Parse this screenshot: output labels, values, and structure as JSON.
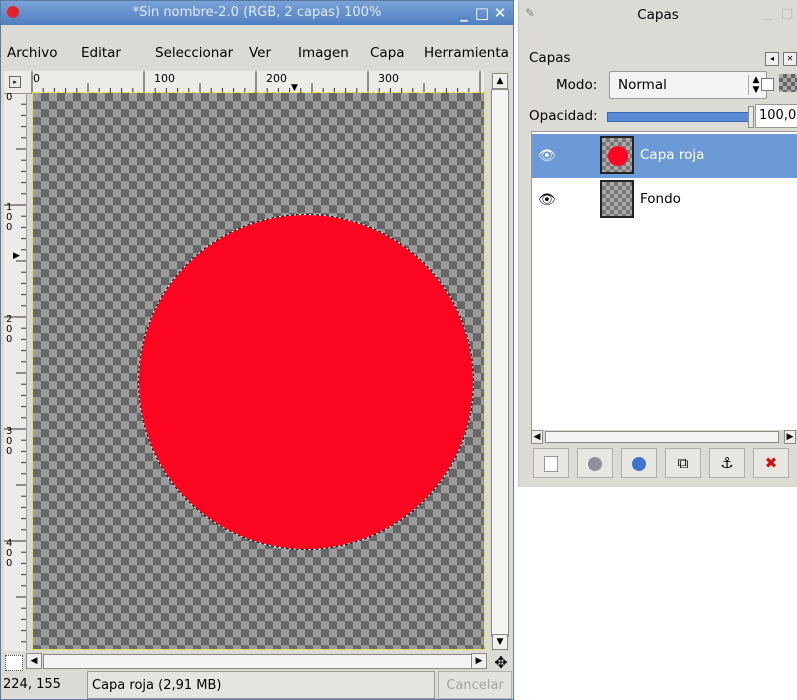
{
  "image_window": {
    "title": "*Sin nombre-2.0 (RGB, 2 capas) 100%",
    "menu": [
      "Archivo",
      "Editar",
      "Seleccionar",
      "Ver",
      "Imagen",
      "Capa",
      "Herramienta"
    ],
    "ruler_h_labels": [
      "0",
      "100",
      "200",
      "300"
    ],
    "ruler_v_labels": [
      "0",
      "100",
      "200",
      "300",
      "400"
    ],
    "status": {
      "coords": "224, 155",
      "info": "Capa roja (2,91 MB)",
      "cancel_label": "Cancelar"
    },
    "colors": {
      "circle": "#fb0521",
      "title_bg": "#5f8dca"
    }
  },
  "layers_dialog": {
    "title": "Capas",
    "header": "Capas",
    "mode_label": "Modo:",
    "mode_value": "Normal",
    "opacity_label": "Opacidad:",
    "opacity_value": "100,0",
    "layers": [
      {
        "name": "Capa roja",
        "visible": true,
        "selected": true
      },
      {
        "name": "Fondo",
        "visible": true,
        "selected": false
      }
    ],
    "buttons": [
      "new-layer-icon",
      "raise-layer-icon",
      "lower-layer-icon",
      "duplicate-layer-icon",
      "anchor-layer-icon",
      "delete-layer-icon"
    ]
  }
}
